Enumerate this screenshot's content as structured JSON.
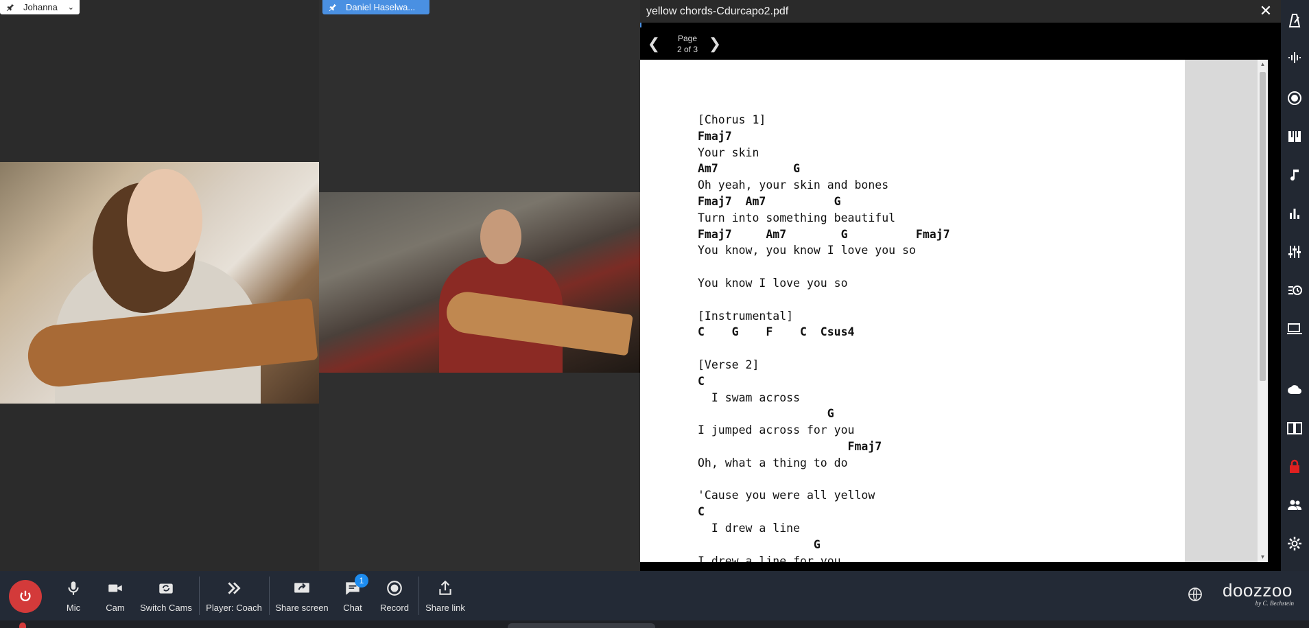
{
  "participants": [
    {
      "name": "Johanna",
      "pinned": true
    },
    {
      "name": "Daniel Haselwa..."
    }
  ],
  "pdf": {
    "title": "yellow chords-Cdurcapo2.pdf",
    "page_label": "Page",
    "page_info": "2 of 3",
    "lines": [
      {
        "text": "[Chorus 1]",
        "chord": false
      },
      {
        "text": "Fmaj7",
        "chord": true
      },
      {
        "text": "Your skin",
        "chord": false
      },
      {
        "text": "Am7           G",
        "chord": true
      },
      {
        "text": "Oh yeah, your skin and bones",
        "chord": false
      },
      {
        "text": "Fmaj7  Am7          G",
        "chord": true
      },
      {
        "text": "Turn into something beautiful",
        "chord": false
      },
      {
        "text": "Fmaj7     Am7        G          Fmaj7",
        "chord": true
      },
      {
        "text": "You know, you know I love you so",
        "chord": false
      },
      {
        "text": "",
        "chord": false
      },
      {
        "text": "You know I love you so",
        "chord": false
      },
      {
        "text": "",
        "chord": false
      },
      {
        "text": "[Instrumental]",
        "chord": false
      },
      {
        "text": "C    G    F    C  Csus4",
        "chord": true
      },
      {
        "text": "",
        "chord": false
      },
      {
        "text": "[Verse 2]",
        "chord": false
      },
      {
        "text": "C",
        "chord": true
      },
      {
        "text": "  I swam across",
        "chord": false
      },
      {
        "text": "                   G",
        "chord": true
      },
      {
        "text": "I jumped across for you",
        "chord": false
      },
      {
        "text": "                      Fmaj7",
        "chord": true
      },
      {
        "text": "Oh, what a thing to do",
        "chord": false
      },
      {
        "text": "",
        "chord": false
      },
      {
        "text": "'Cause you were all yellow",
        "chord": false
      },
      {
        "text": "C",
        "chord": true
      },
      {
        "text": "  I drew a line",
        "chord": false
      },
      {
        "text": "                 G",
        "chord": true
      },
      {
        "text": "I drew a line for you",
        "chord": false
      }
    ]
  },
  "toolbar": {
    "mic": "Mic",
    "cam": "Cam",
    "switch_cams": "Switch Cams",
    "player": "Player: Coach",
    "share_screen": "Share screen",
    "chat": "Chat",
    "chat_badge": "1",
    "record": "Record",
    "share_link": "Share link"
  },
  "brand": {
    "name": "doozzoo",
    "sub": "by C. Bechstein"
  },
  "sidebar_icons": [
    "metronome-icon",
    "tuner-icon",
    "record-dot-icon",
    "piano-icon",
    "music-note-icon",
    "bar-chart-icon",
    "mixer-icon",
    "history-icon",
    "devices-icon",
    "cloud-icon",
    "layout-icon",
    "lock-icon",
    "people-icon",
    "settings-icon"
  ],
  "colors": {
    "accent": "#4a90e2",
    "end_call": "#d33a3a",
    "badge": "#1d8cf0",
    "lock": "#e02020"
  }
}
